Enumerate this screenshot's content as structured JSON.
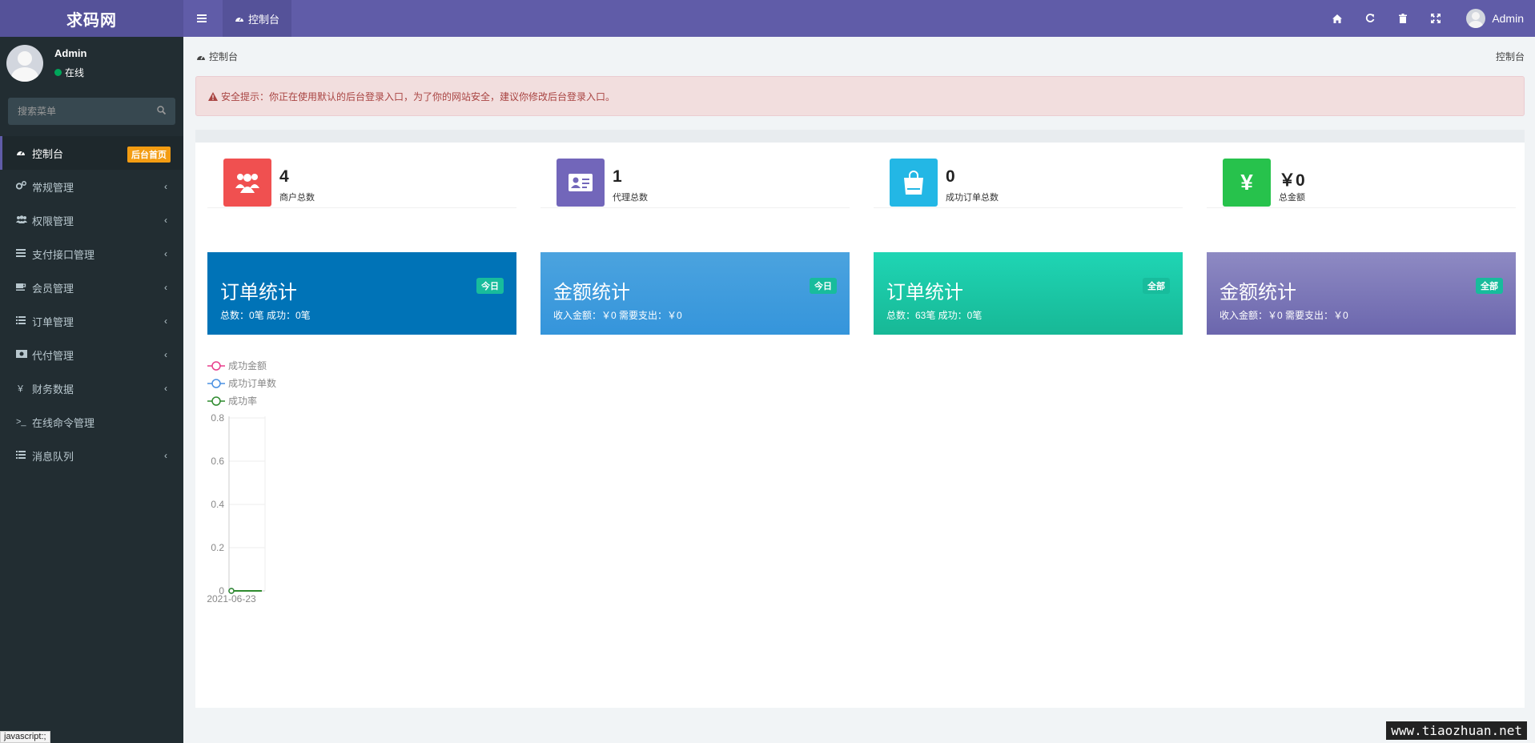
{
  "header": {
    "logo": "求码网",
    "tab_label": "控制台",
    "username": "Admin"
  },
  "sidebar": {
    "user_name": "Admin",
    "user_status": "在线",
    "search_placeholder": "搜索菜单",
    "items": [
      {
        "label": "控制台",
        "icon": "dashboard-icon",
        "badge": "后台首页"
      },
      {
        "label": "常规管理",
        "icon": "cogs-icon"
      },
      {
        "label": "权限管理",
        "icon": "group-icon"
      },
      {
        "label": "支付接口管理",
        "icon": "list-icon"
      },
      {
        "label": "会员管理",
        "icon": "coffee-icon"
      },
      {
        "label": "订单管理",
        "icon": "list-icon"
      },
      {
        "label": "代付管理",
        "icon": "money-icon"
      },
      {
        "label": "财务数据",
        "icon": "yen-icon"
      },
      {
        "label": "在线命令管理",
        "icon": "terminal-icon"
      },
      {
        "label": "消息队列",
        "icon": "list-icon"
      }
    ]
  },
  "breadcrumb": {
    "left": "控制台",
    "right": "控制台"
  },
  "alert": {
    "text": "安全提示：你正在使用默认的后台登录入口，为了你的网站安全，建议你修改后台登录入口。"
  },
  "stats": [
    {
      "value": "4",
      "label": "商户总数",
      "color": "#dd4b39",
      "icon": "users-icon"
    },
    {
      "value": "1",
      "label": "代理总数",
      "color": "#605ca8",
      "icon": "id-card-icon"
    },
    {
      "value": "0",
      "label": "成功订单总数",
      "color": "#00c0ef",
      "icon": "shopping-bag-icon"
    },
    {
      "value": "￥0",
      "label": "总金额",
      "color": "#00a65a",
      "icon": "yen-icon"
    }
  ],
  "cards": [
    {
      "title": "订单统计",
      "badge": "今日",
      "sub": "总数：0笔 成功：0笔",
      "color": "#0073b7"
    },
    {
      "title": "金额统计",
      "badge": "今日",
      "sub": "收入金额：￥0 需要支出：￥0",
      "color": "#3c9cdb"
    },
    {
      "title": "订单统计",
      "badge": "全部",
      "sub": "总数：63笔 成功：0笔",
      "color": "#18c8a5"
    },
    {
      "title": "金额统计",
      "badge": "全部",
      "sub": "收入金额：￥0 需要支出：￥0",
      "color": "#7a76b6"
    }
  ],
  "chart_data": {
    "type": "line",
    "x": [
      "2021-06-23"
    ],
    "series": [
      {
        "name": "成功金额",
        "values": [
          0
        ],
        "color": "#e83e8c"
      },
      {
        "name": "成功订单数",
        "values": [
          0
        ],
        "color": "#4a90e2"
      },
      {
        "name": "成功率",
        "values": [
          0
        ],
        "color": "#2e8b2e"
      }
    ],
    "yticks": [
      "0",
      "0.2",
      "0.4",
      "0.6",
      "0.8"
    ],
    "ylim": [
      0,
      0.8
    ]
  },
  "status_bar": "javascript:;",
  "watermark": "www.tiaozhuan.net"
}
